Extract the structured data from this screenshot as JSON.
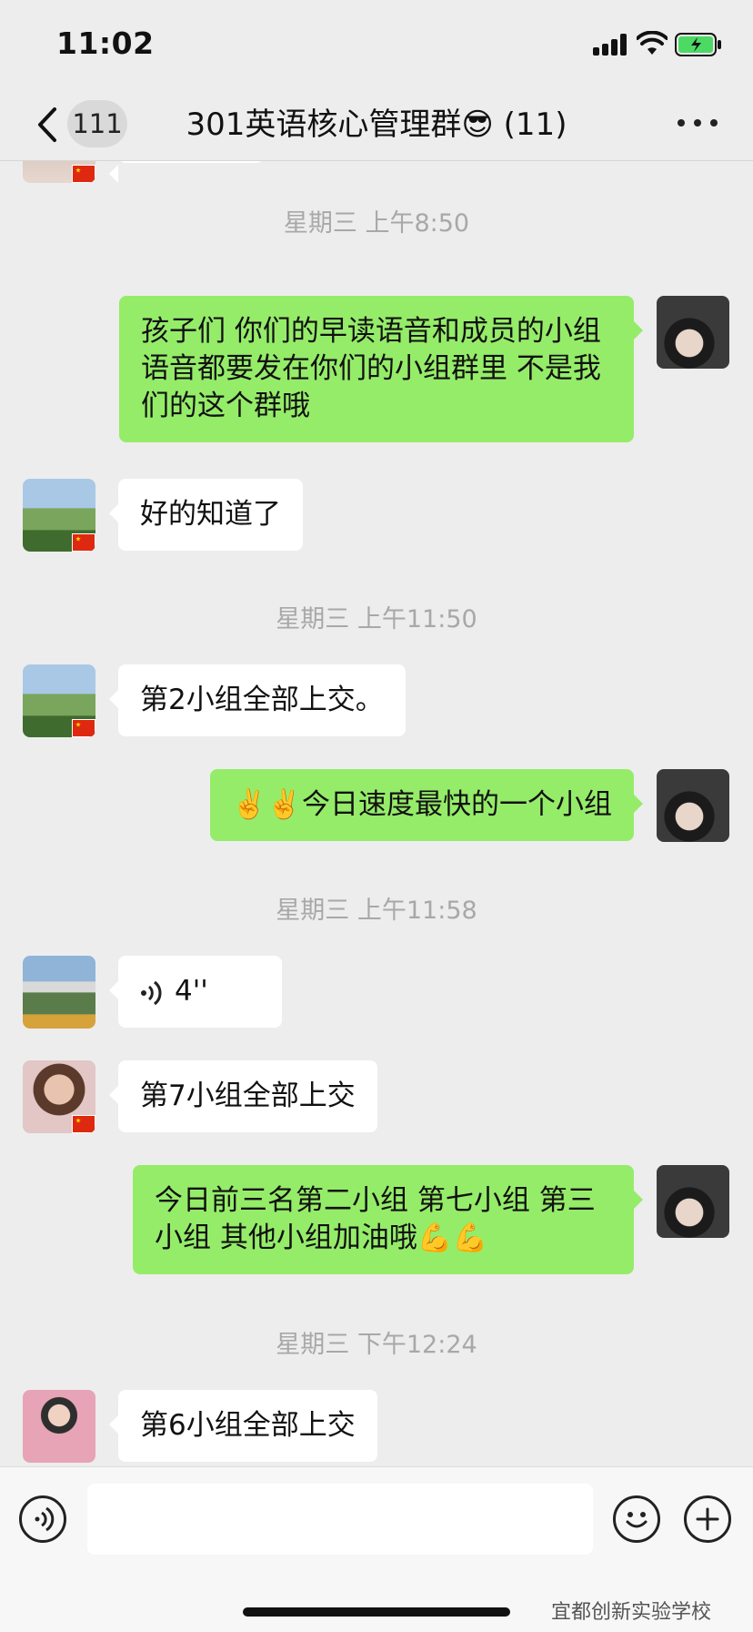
{
  "status_bar": {
    "time": "11:02"
  },
  "nav": {
    "unread_count": "111",
    "title": "301英语核心管理群😎 (11)"
  },
  "messages": {
    "ts_1": "星期三 上午8:50",
    "m1": "孩子们 你们的早读语音和成员的小组语音都要发在你们的小组群里 不是我们的这个群哦",
    "m2": "好的知道了",
    "ts_2": "星期三 上午11:50",
    "m3": "第2小组全部上交。",
    "m4": "✌️✌️今日速度最快的一个小组",
    "ts_3": "星期三 上午11:58",
    "m5_voice_duration": "4''",
    "m6": "第7小组全部上交",
    "m7": "今日前三名第二小组 第七小组 第三小组 其他小组加油哦💪💪",
    "ts_4": "星期三 下午12:24",
    "m8": "第6小组全部上交"
  },
  "input_bar": {
    "placeholder": "",
    "watermark": "宜都创新实验学校"
  },
  "colors": {
    "background": "#ededed",
    "outgoing_bubble": "#95ec69",
    "incoming_bubble": "#ffffff",
    "timestamp_text": "#a8a8a8"
  },
  "icons": {
    "back": "chevron-left-icon",
    "more": "more-dots-icon",
    "voice_mode": "voice-icon",
    "emoji": "emoji-icon",
    "plus": "plus-icon",
    "voice_message": "voice-wave-icon"
  }
}
